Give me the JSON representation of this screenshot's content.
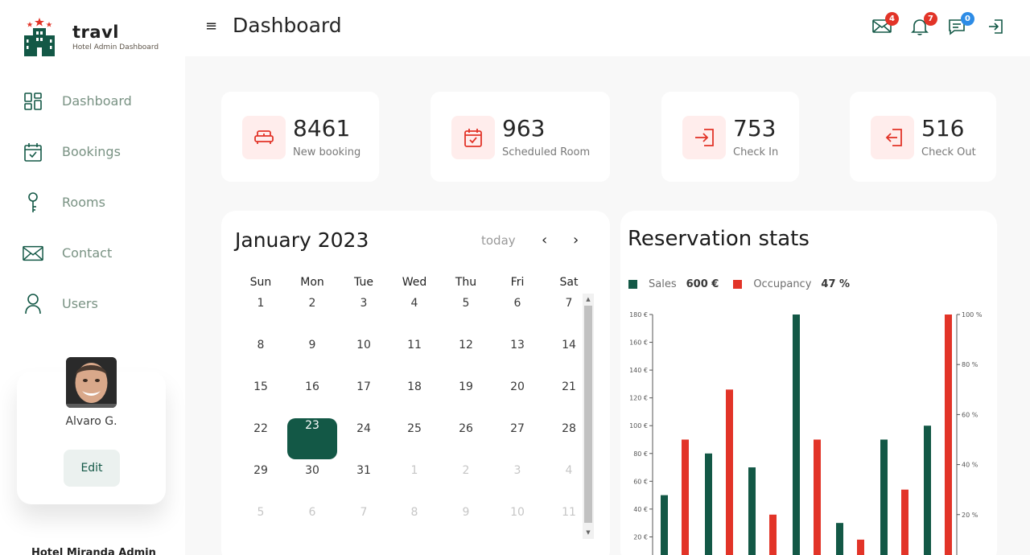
{
  "brand": {
    "name": "travl",
    "subtitle": "Hotel Admin Dashboard"
  },
  "sidebar": {
    "items": [
      {
        "label": "Dashboard",
        "icon": "dashboard-icon"
      },
      {
        "label": "Bookings",
        "icon": "calendar-check-icon"
      },
      {
        "label": "Rooms",
        "icon": "key-icon"
      },
      {
        "label": "Contact",
        "icon": "mail-icon"
      },
      {
        "label": "Users",
        "icon": "user-icon"
      }
    ],
    "profile": {
      "name": "Alvaro G.",
      "edit_label": "Edit"
    },
    "footer": "Hotel Miranda Admin"
  },
  "header": {
    "title": "Dashboard",
    "menu_glyph": "≡",
    "badges": {
      "messages": "4",
      "notifications": "7",
      "chat": "0"
    },
    "colors": {
      "badge_red": "#e23428",
      "badge_blue": "#2d8ce6"
    }
  },
  "kpis": [
    {
      "value": "8461",
      "label": "New booking",
      "icon": "bed-icon"
    },
    {
      "value": "963",
      "label": "Scheduled Room",
      "icon": "calendar-check-icon"
    },
    {
      "value": "753",
      "label": "Check In",
      "icon": "check-in-icon"
    },
    {
      "value": "516",
      "label": "Check Out",
      "icon": "check-out-icon"
    }
  ],
  "calendar": {
    "title": "January 2023",
    "today_label": "today",
    "prev_glyph": "‹",
    "next_glyph": "›",
    "weekdays": [
      "Sun",
      "Mon",
      "Tue",
      "Wed",
      "Thu",
      "Fri",
      "Sat"
    ],
    "weeks": [
      [
        "1",
        "2",
        "3",
        "4",
        "5",
        "6",
        "7"
      ],
      [
        "8",
        "9",
        "10",
        "11",
        "12",
        "13",
        "14"
      ],
      [
        "15",
        "16",
        "17",
        "18",
        "19",
        "20",
        "21"
      ],
      [
        "22",
        "23",
        "24",
        "25",
        "26",
        "27",
        "28"
      ],
      [
        "29",
        "30",
        "31",
        "1",
        "2",
        "3",
        "4"
      ],
      [
        "5",
        "6",
        "7",
        "8",
        "9",
        "10",
        "11"
      ]
    ],
    "selected": "23",
    "accent": "#135846"
  },
  "stats": {
    "title": "Reservation stats",
    "legend": [
      {
        "name": "Sales",
        "value": "600 €",
        "color": "#135846"
      },
      {
        "name": "Occupancy",
        "value": "47 %",
        "color": "#e23428"
      }
    ]
  },
  "chart_data": {
    "type": "bar",
    "y_left_ticks": [
      "180 €",
      "160 €",
      "140 €",
      "120 €",
      "100 €",
      "80 €",
      "60 €",
      "40 €",
      "20 €"
    ],
    "y_left_range": [
      0,
      180
    ],
    "y_right_ticks": [
      "100 %",
      "80 %",
      "60 %",
      "40 %",
      "20 %"
    ],
    "y_right_range": [
      0,
      100
    ],
    "series": [
      {
        "name": "Sales",
        "axis": "left",
        "color": "#135846",
        "values": [
          50,
          80,
          70,
          180,
          30,
          90,
          100
        ]
      },
      {
        "name": "Occupancy",
        "axis": "right",
        "color": "#e23428",
        "values": [
          50,
          70,
          20,
          50,
          10,
          30,
          100
        ]
      }
    ]
  }
}
